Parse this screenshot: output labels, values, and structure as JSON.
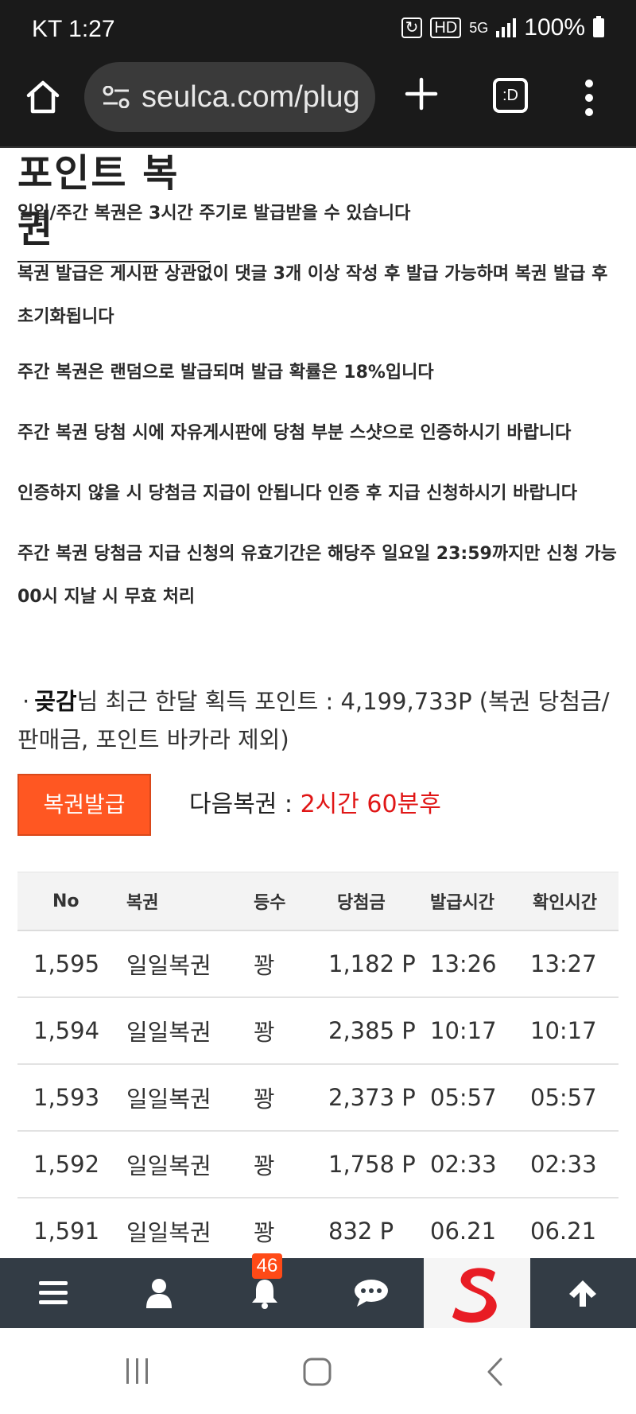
{
  "status_bar": {
    "carrier_time": "KT 1:27",
    "network": "5G",
    "hd": "HD",
    "battery": "100%"
  },
  "browser": {
    "url": "seulca.com/plug",
    "tabs_label": ":D"
  },
  "page": {
    "title": "포인트 복권",
    "notices": [
      "일일/주간 복권은 3시간 주기로 발급받을 수 있습니다",
      "복권 발급은 게시판 상관없이 댓글 3개 이상 작성 후 발급 가능하며 복권 발급 후 초기화됩니다",
      "주간 복권은 랜덤으로 발급되며 발급 확률은 18%입니다",
      "주간 복권 당첨 시에 자유게시판에 당첨 부분 스샷으로 인증하시기 바랍니다",
      "인증하지 않을 시 당첨금 지급이 안됩니다 인증 후 지급 신청하시기 바랍니다",
      "주간 복권 당첨금 지급 신청의 유효기간은 해당주 일요일 23:59까지만 신청 가능 00시 지날 시 무효 처리"
    ],
    "points_prefix": "·",
    "user_name": "곶감",
    "points_text": "님 최근 한달 획득 포인트 : 4,199,733P (복권 당첨금/판매금, 포인트 바카라 제외)",
    "issue_button": "복권발급",
    "next_label": "다음복권 : ",
    "next_value": "2시간 60분후"
  },
  "table": {
    "headers": [
      "No",
      "복권",
      "등수",
      "당첨금",
      "발급시간",
      "확인시간"
    ],
    "rows": [
      [
        "1,595",
        "일일복권",
        "꽝",
        "1,182 P",
        "13:26",
        "13:27"
      ],
      [
        "1,594",
        "일일복권",
        "꽝",
        "2,385 P",
        "10:17",
        "10:17"
      ],
      [
        "1,593",
        "일일복권",
        "꽝",
        "2,373 P",
        "05:57",
        "05:57"
      ],
      [
        "1,592",
        "일일복권",
        "꽝",
        "1,758 P",
        "02:33",
        "02:33"
      ],
      [
        "1,591",
        "일일복권",
        "꽝",
        "832 P",
        "06.21",
        "06.21"
      ]
    ]
  },
  "site_nav": {
    "notification_count": "46",
    "icons": [
      "menu-icon",
      "user-icon",
      "bell-icon",
      "chat-icon",
      "site-logo",
      "arrow-up-icon"
    ]
  },
  "colors": {
    "accent": "#ff5722",
    "next_time": "#e01616",
    "nav_bg": "#333c45",
    "logo_red": "#e81c24"
  }
}
